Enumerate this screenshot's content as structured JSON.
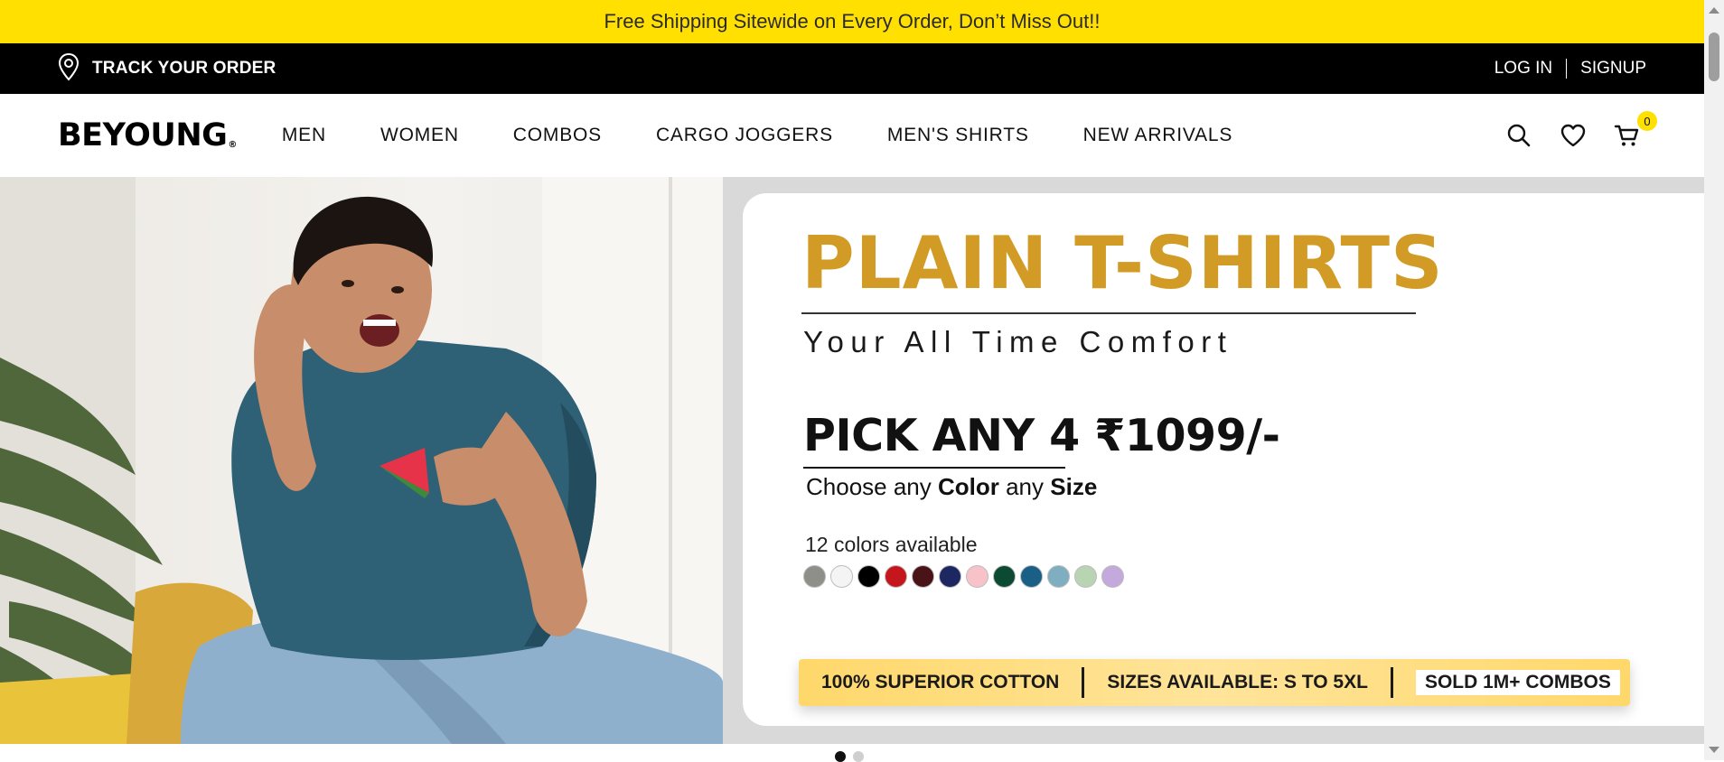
{
  "announcement": {
    "text": "Free Shipping Sitewide on Every Order, Don’t Miss Out!!"
  },
  "utility_bar": {
    "track_order": "TRACK YOUR ORDER",
    "login": "LOG IN",
    "signup": "SIGNUP"
  },
  "nav": {
    "logo": "BEYOUNG",
    "logo_mark": "®",
    "items": [
      {
        "label": "MEN"
      },
      {
        "label": "WOMEN"
      },
      {
        "label": "COMBOS"
      },
      {
        "label": "CARGO JOGGERS"
      },
      {
        "label": "MEN'S SHIRTS"
      },
      {
        "label": "NEW ARRIVALS"
      }
    ],
    "icons": [
      "search-icon",
      "heart-icon",
      "cart-icon"
    ],
    "cart_count": "0"
  },
  "hero": {
    "title": "PLAIN T-SHIRTS",
    "subtitle": "Your All Time Comfort",
    "offer": "PICK ANY 4 ₹1099/-",
    "choose_prefix": "Choose any ",
    "choose_color": "Color",
    "choose_middle": " any ",
    "choose_size": "Size",
    "colors_label": "12 colors available",
    "swatches": [
      "#8f8f89",
      "#f4f4f4",
      "#000000",
      "#c4161c",
      "#4a1318",
      "#1d2761",
      "#f7c3c9",
      "#0d4a33",
      "#1a5f86",
      "#7faec0",
      "#b8d4b2",
      "#c3a9dc"
    ],
    "benefits": [
      "100% SUPERIOR COTTON",
      "SIZES AVAILABLE: S TO 5XL",
      "SOLD 1M+ COMBOS"
    ],
    "accent_color": "#D29B26",
    "slides": 2,
    "active_slide": 1
  },
  "colors": {
    "announcement_bg": "#FFE000",
    "utility_bg": "#000000"
  }
}
